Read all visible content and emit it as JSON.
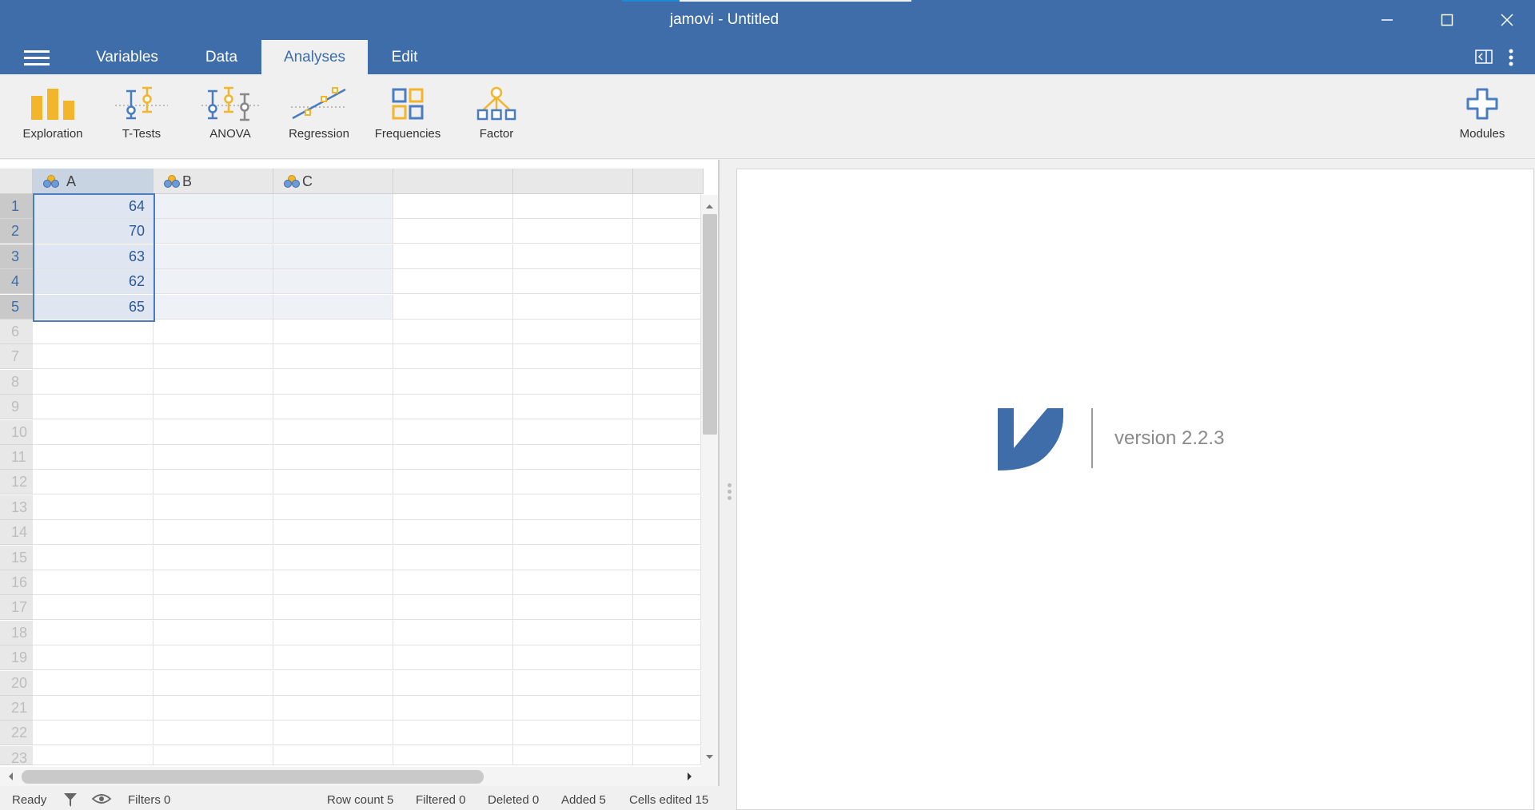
{
  "window": {
    "title": "jamovi - Untitled",
    "minimize_label": "—",
    "maximize_label": "☐",
    "close_label": "✕"
  },
  "tabs": [
    {
      "label": "Variables"
    },
    {
      "label": "Data"
    },
    {
      "label": "Analyses",
      "active": true
    },
    {
      "label": "Edit"
    }
  ],
  "toolbar": {
    "items": [
      {
        "label": "Exploration",
        "icon": "bar-chart-icon"
      },
      {
        "label": "T-Tests",
        "icon": "t-test-icon"
      },
      {
        "label": "ANOVA",
        "icon": "anova-icon"
      },
      {
        "label": "Regression",
        "icon": "regression-icon"
      },
      {
        "label": "Frequencies",
        "icon": "frequencies-icon"
      },
      {
        "label": "Factor",
        "icon": "factor-icon"
      }
    ],
    "modules_label": "Modules"
  },
  "sheet": {
    "columns": [
      {
        "name": "A",
        "selected": true
      },
      {
        "name": "B"
      },
      {
        "name": "C"
      },
      {
        "name": ""
      },
      {
        "name": ""
      },
      {
        "name": ""
      }
    ],
    "rows": [
      "1",
      "2",
      "3",
      "4",
      "5",
      "6",
      "7",
      "8",
      "9",
      "10",
      "11",
      "12",
      "13",
      "14",
      "15",
      "16",
      "17",
      "18",
      "19",
      "20",
      "21",
      "22",
      "23"
    ],
    "values_A": [
      "64",
      "70",
      "63",
      "62",
      "65"
    ]
  },
  "results": {
    "version": "version 2.2.3"
  },
  "status": {
    "ready": "Ready",
    "filters": "Filters 0",
    "row_count": "Row count 5",
    "filtered": "Filtered 0",
    "deleted": "Deleted 0",
    "added": "Added 5",
    "cells_edited": "Cells edited 15"
  },
  "colors": {
    "brand_blue": "#3e6da9",
    "icon_orange": "#f3b52c",
    "icon_blue": "#4a7cc2"
  }
}
